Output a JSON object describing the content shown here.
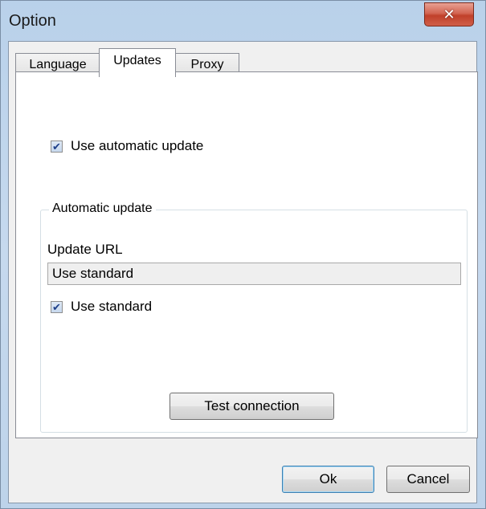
{
  "window": {
    "title": "Option",
    "close_glyph": "✕"
  },
  "tabs": [
    {
      "label": "Language",
      "active": false
    },
    {
      "label": "Updates",
      "active": true
    },
    {
      "label": "Proxy",
      "active": false
    }
  ],
  "updates": {
    "use_automatic_update": {
      "label": "Use automatic update",
      "checked": true
    },
    "group": {
      "legend": "Automatic update",
      "url_label": "Update URL",
      "url_value": "Use standard",
      "use_standard": {
        "label": "Use standard",
        "checked": true
      },
      "test_button": "Test connection"
    }
  },
  "footer": {
    "ok_label": "Ok",
    "cancel_label": "Cancel"
  },
  "icons": {
    "check": "✔"
  },
  "colors": {
    "title_bar": "#b9d1ea",
    "close_button": "#c0402a",
    "default_button_border": "#3c7fb1"
  }
}
